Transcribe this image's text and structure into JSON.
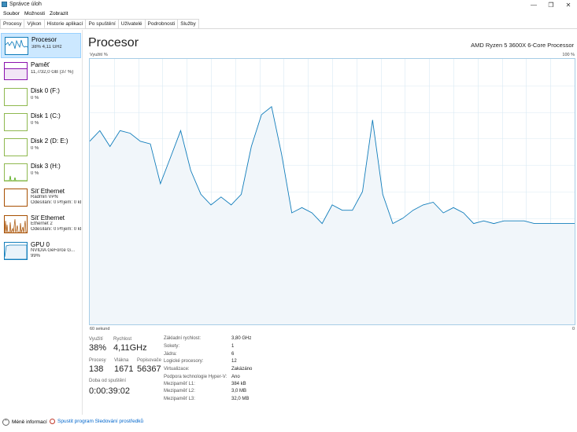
{
  "window": {
    "title": "Správce úloh",
    "icon": "task-manager-icon"
  },
  "menu": [
    "Soubor",
    "Možnosti",
    "Zobrazit"
  ],
  "tabs": [
    "Procesy",
    "Výkon",
    "Historie aplikací",
    "Po spuštění",
    "Uživatelé",
    "Podrobnosti",
    "Služby"
  ],
  "active_tab": "Výkon",
  "sidebar": [
    {
      "name": "Procesor",
      "sub1": "38% 4,11 GHz",
      "sub2": "",
      "selected": true,
      "color": "#117dbb"
    },
    {
      "name": "Paměť",
      "sub1": "11,7/32,0 GB (37 %)",
      "sub2": "",
      "color": "#8b12ae"
    },
    {
      "name": "Disk 0 (F:)",
      "sub1": "0 %",
      "sub2": "",
      "color": "#4da60c"
    },
    {
      "name": "Disk 1 (C:)",
      "sub1": "0 %",
      "sub2": "",
      "color": "#4da60c"
    },
    {
      "name": "Disk 2 (D: E:)",
      "sub1": "0 %",
      "sub2": "",
      "color": "#4da60c"
    },
    {
      "name": "Disk 3 (H:)",
      "sub1": "0 %",
      "sub2": "",
      "color": "#4da60c"
    },
    {
      "name": "Síť Ethernet",
      "sub1": "Radmin VPN",
      "sub2": "Odesílání: 0 Příjem: 0 kb",
      "color": "#a74f01"
    },
    {
      "name": "Síť Ethernet",
      "sub1": "Ethernet 2",
      "sub2": "Odesílání: 0 Příjem: 0 kb",
      "color": "#a74f01"
    },
    {
      "name": "GPU 0",
      "sub1": "NVIDIA GeForce G...",
      "sub2": "99%",
      "color": "#117dbb"
    }
  ],
  "main": {
    "title": "Procesor",
    "cpu_model": "AMD Ryzen 5 3600X 6-Core Processor",
    "graph_label": "Využití %",
    "graph_max": "100 %",
    "graph_time": "60 sekund",
    "graph_min": "0"
  },
  "stats": {
    "utilization_label": "Využití",
    "utilization": "38%",
    "speed_label": "Rychlost",
    "speed": "4,11GHz",
    "processes_label": "Procesy",
    "processes": "138",
    "threads_label": "Vlákna",
    "threads": "1671",
    "handles_label": "Popisovače",
    "handles": "56367",
    "uptime_label": "Doba od spuštění",
    "uptime": "0:00:39:02"
  },
  "info": [
    {
      "k": "Základní rychlost:",
      "v": "3,80 GHz"
    },
    {
      "k": "Sokety:",
      "v": "1"
    },
    {
      "k": "Jádra:",
      "v": "6"
    },
    {
      "k": "Logické procesory:",
      "v": "12"
    },
    {
      "k": "Virtualizace:",
      "v": "Zakázáno"
    },
    {
      "k": "Podpora technologie Hyper-V:",
      "v": "Ano"
    },
    {
      "k": "Mezipaměť L1:",
      "v": "384 kB"
    },
    {
      "k": "Mezipaměť L2:",
      "v": "3,0 MB"
    },
    {
      "k": "Mezipaměť L3:",
      "v": "32,0 MB"
    }
  ],
  "footer": {
    "less_info": "Méně informací",
    "resource_monitor": "Spustit program Sledování prostředků"
  },
  "cpu_history": [
    69,
    73,
    67,
    73,
    72,
    69,
    68,
    53,
    63,
    73,
    58,
    49,
    45,
    48,
    45,
    49,
    67,
    79,
    82,
    64,
    42,
    44,
    42,
    38,
    45,
    43,
    43,
    50,
    77,
    49,
    38,
    40,
    43,
    45,
    46,
    42,
    44,
    42,
    38,
    39,
    38,
    39,
    39,
    39,
    38,
    38,
    38,
    38,
    38
  ],
  "colors": {
    "accent": "#117dbb",
    "graph_border": "#a7cde6",
    "graph_fill": "#f1f6fa",
    "grid": "#d9eaf4",
    "selected_bg": "#cce8ff"
  }
}
